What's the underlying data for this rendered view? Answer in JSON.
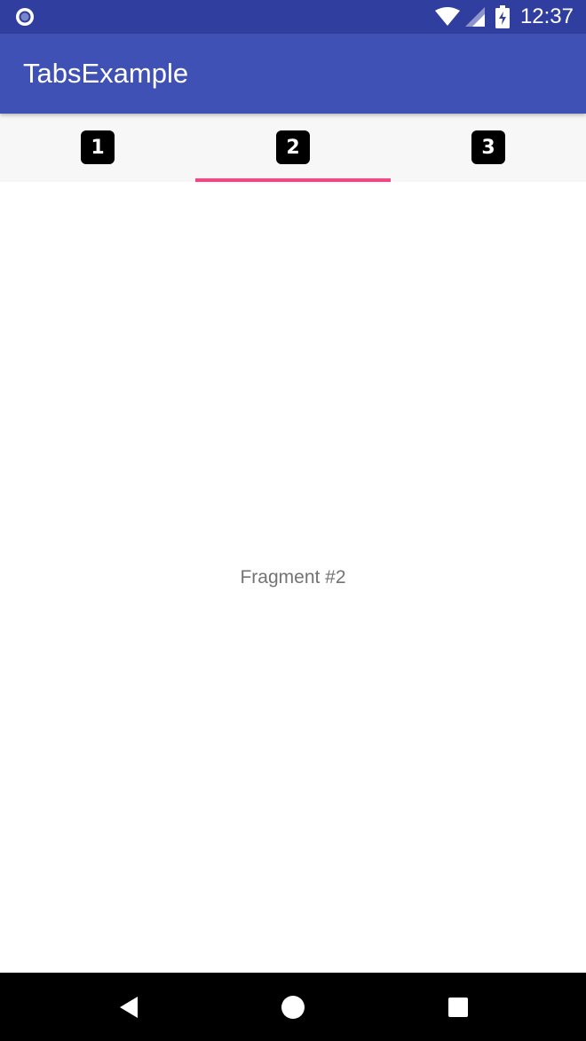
{
  "status_bar": {
    "time": "12:37",
    "left_icon": "circle-notification-icon",
    "wifi_icon": "wifi-icon",
    "signal_icon": "cell-signal-icon",
    "battery_icon": "battery-charging-icon",
    "background": "#303f9f"
  },
  "app_bar": {
    "title": "TabsExample",
    "background": "#3f51b5"
  },
  "tabs": {
    "items": [
      {
        "label": "1",
        "selected": false
      },
      {
        "label": "2",
        "selected": true
      },
      {
        "label": "3",
        "selected": false
      }
    ],
    "indicator_color": "#ff4081"
  },
  "content": {
    "text": "Fragment #2"
  },
  "nav_bar": {
    "back_icon": "back-triangle-icon",
    "home_icon": "home-circle-icon",
    "recents_icon": "recents-square-icon"
  }
}
